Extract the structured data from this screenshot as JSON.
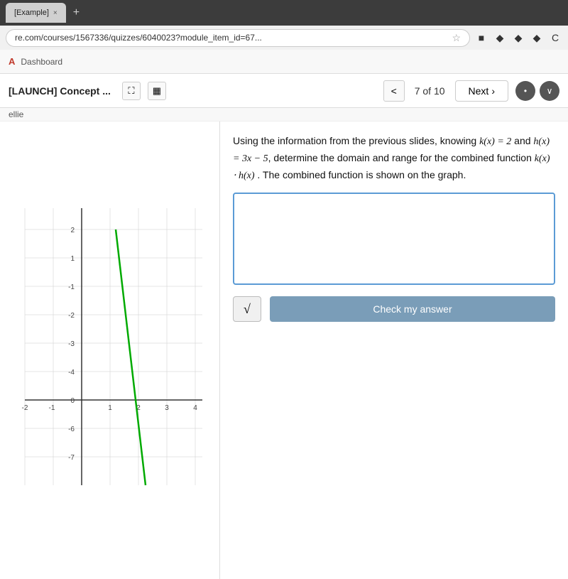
{
  "browser": {
    "tab_label": "[Example]",
    "tab_close": "×",
    "tab_plus": "+",
    "address": "re.com/courses/1567336/quizzes/6040023?module_item_id=67...",
    "star_icon": "☆",
    "browser_icons": [
      "■",
      "◆",
      "◆",
      "◆",
      "×",
      "C"
    ]
  },
  "lms_nav": {
    "logo": "A",
    "link": "Dashboard"
  },
  "quiz_header": {
    "title": "[LAUNCH] Concept ...",
    "expand_icon": "⛶",
    "calculator_icon": "⊞",
    "prev_arrow": "<",
    "page_indicator": "7 of 10",
    "next_label": "Next",
    "next_arrow": "›",
    "dots_label": "•",
    "chevron_label": "∨"
  },
  "user_label": "ellie",
  "question": {
    "text_1": "Using the information from the previous slides, knowing ",
    "math_1": "k(x) = 2",
    "text_2": " and ",
    "math_2": "h(x) = 3x − 5",
    "text_3": ", determine the domain and range for the combined function ",
    "math_3": "k(x) · h(x)",
    "text_4": " . The combined function is shown on the graph.",
    "textarea_placeholder": "",
    "textarea_cursor": "I"
  },
  "actions": {
    "sqrt_label": "√",
    "check_answer_label": "Check my answer"
  },
  "graph": {
    "x_min": -2,
    "x_max": 6,
    "y_min": -10,
    "y_max": 3,
    "line_color": "#00aa00",
    "grid_color": "#cccccc",
    "axis_color": "#333333"
  }
}
